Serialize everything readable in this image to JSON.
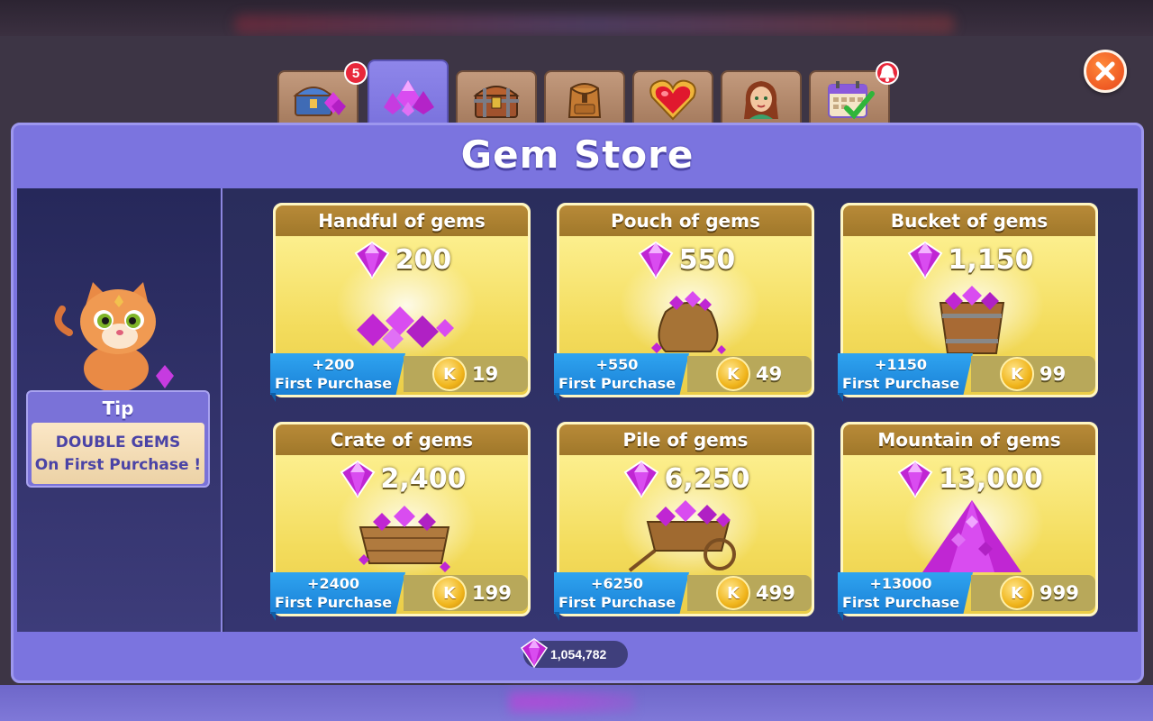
{
  "tabs": [
    {
      "icon": "treasure-gems-icon",
      "badge": "5"
    },
    {
      "icon": "gem-pile-icon",
      "badge": ""
    },
    {
      "icon": "chest-icon",
      "badge": ""
    },
    {
      "icon": "backpack-icon",
      "badge": ""
    },
    {
      "icon": "heart-icon",
      "badge": ""
    },
    {
      "icon": "character-portrait-icon",
      "badge": ""
    },
    {
      "icon": "calendar-check-icon",
      "badge": "bell"
    }
  ],
  "store": {
    "title": "Gem Store",
    "balance": "1,054,782",
    "tip_title": "Tip",
    "tip_line1": "DOUBLE GEMS",
    "tip_line2": "On First Purchase !",
    "first_purchase_label": "First Purchase",
    "packs": [
      {
        "name": "Handful of gems",
        "amount": "200",
        "bonus": "+200",
        "price": "19",
        "art": "gem-cluster"
      },
      {
        "name": "Pouch of gems",
        "amount": "550",
        "bonus": "+550",
        "price": "49",
        "art": "gem-pouch"
      },
      {
        "name": "Bucket of gems",
        "amount": "1,150",
        "bonus": "+1150",
        "price": "99",
        "art": "gem-bucket"
      },
      {
        "name": "Crate of gems",
        "amount": "2,400",
        "bonus": "+2400",
        "price": "199",
        "art": "gem-crate"
      },
      {
        "name": "Pile of gems",
        "amount": "6,250",
        "bonus": "+6250",
        "price": "499",
        "art": "gem-cart"
      },
      {
        "name": "Mountain of gems",
        "amount": "13,000",
        "bonus": "+13000",
        "price": "999",
        "art": "gem-mountain"
      }
    ],
    "coin_letter": "K"
  },
  "colors": {
    "panel": "#7b74df",
    "gem": "#c026d3",
    "ribbon": "#1a80d6",
    "close": "#e8451a"
  }
}
